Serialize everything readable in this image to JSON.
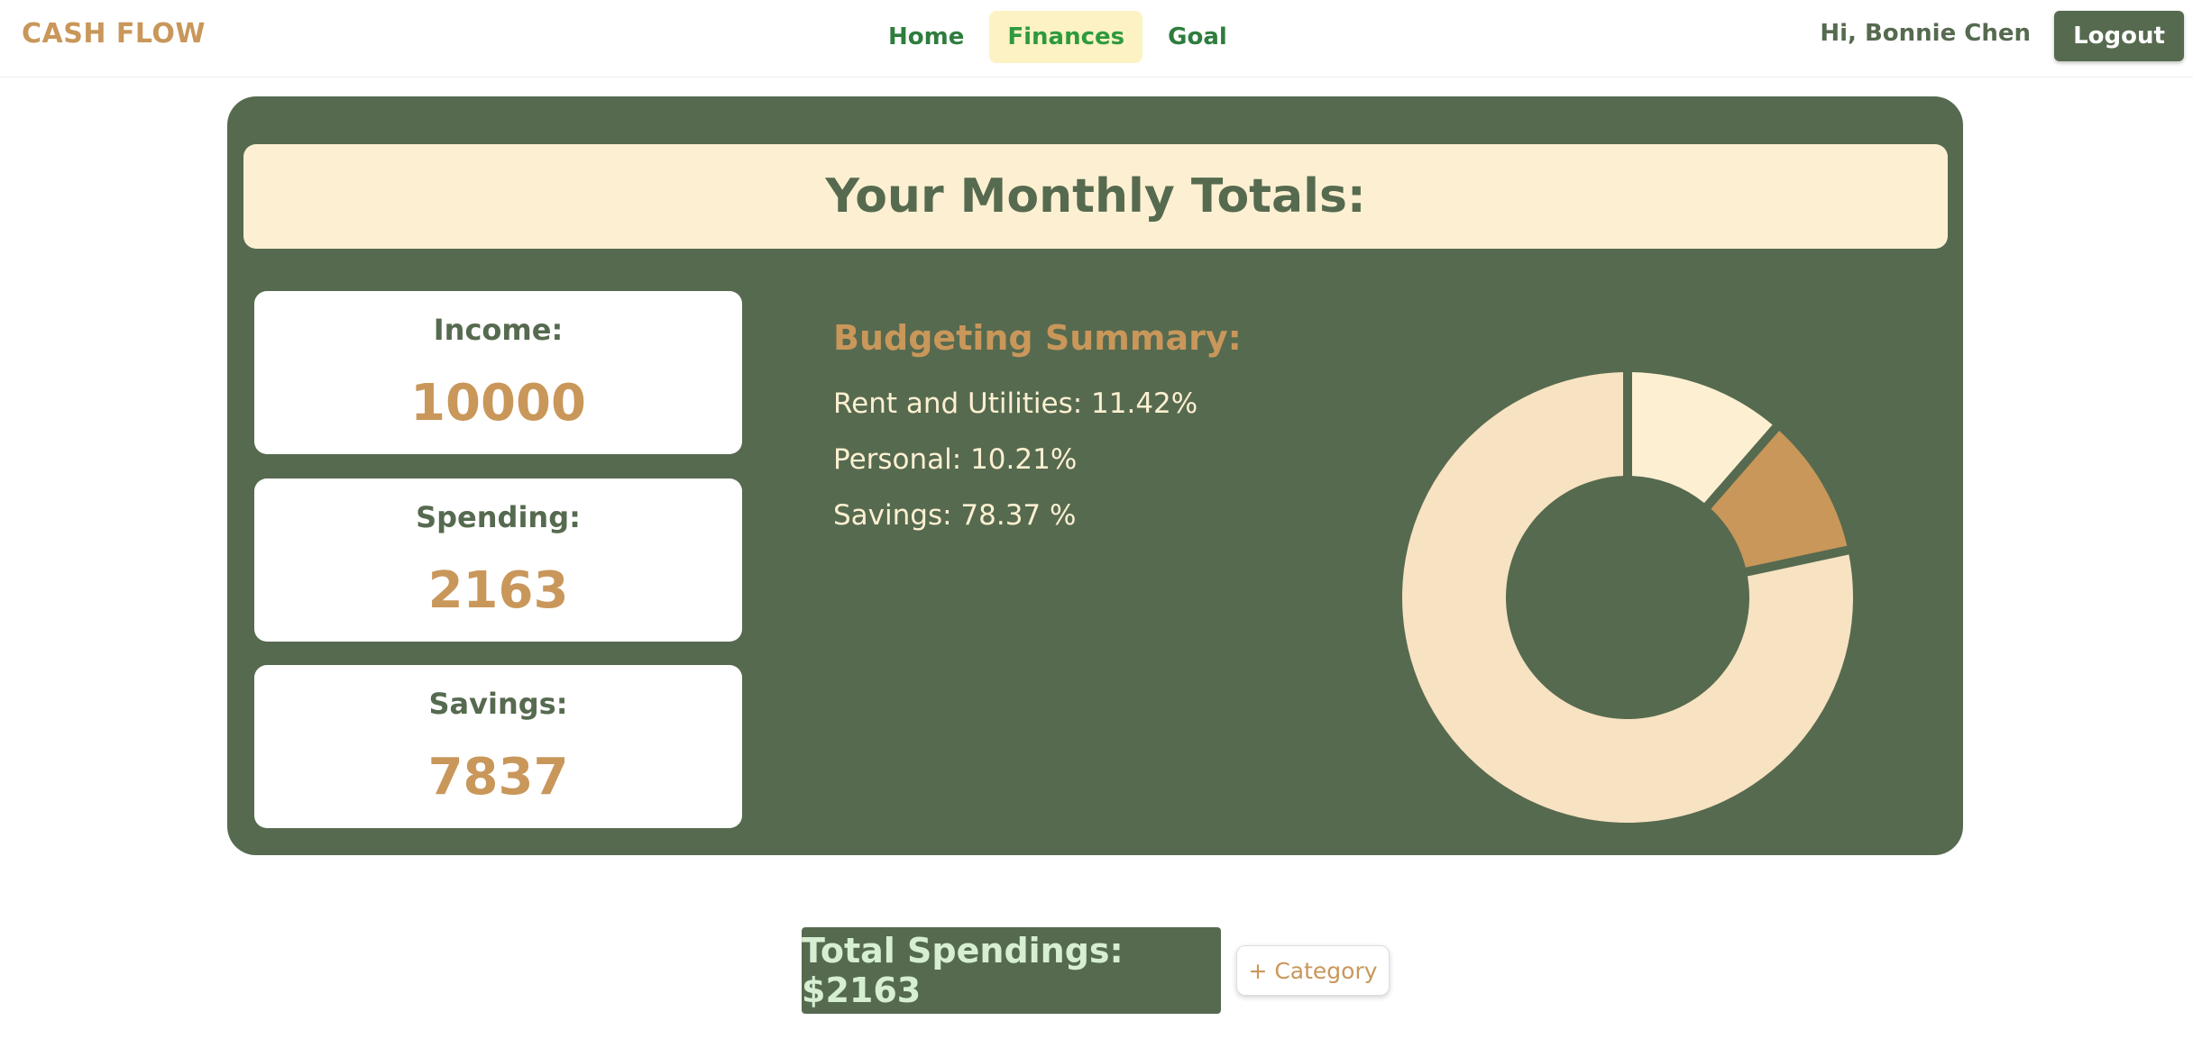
{
  "app": {
    "brand": "CASH FLOW"
  },
  "nav": {
    "links": [
      "Home",
      "Finances",
      "Goal"
    ],
    "active": "Finances",
    "greeting": "Hi, Bonnie Chen",
    "logout_label": "Logout"
  },
  "totals": {
    "title": "Your Monthly Totals:",
    "cards": [
      {
        "label": "Income:",
        "value": "10000"
      },
      {
        "label": "Spending:",
        "value": "2163"
      },
      {
        "label": "Savings:",
        "value": "7837"
      }
    ]
  },
  "summary": {
    "title": "Budgeting Summary:",
    "items": [
      "Rent and Utilities: 11.42%",
      "Personal: 10.21%",
      "Savings: 78.37 %"
    ]
  },
  "chart_data": {
    "type": "pie",
    "categories": [
      "Rent and Utilities",
      "Personal",
      "Savings"
    ],
    "values": [
      11.42,
      10.21,
      78.37
    ],
    "colors": [
      "#fdf0d2",
      "#c9975a",
      "#f7e2c2"
    ],
    "hole_color": "#566a4f"
  },
  "footer": {
    "total_label": "Total Spendings: $2163",
    "add_category_label": "+ Category"
  }
}
